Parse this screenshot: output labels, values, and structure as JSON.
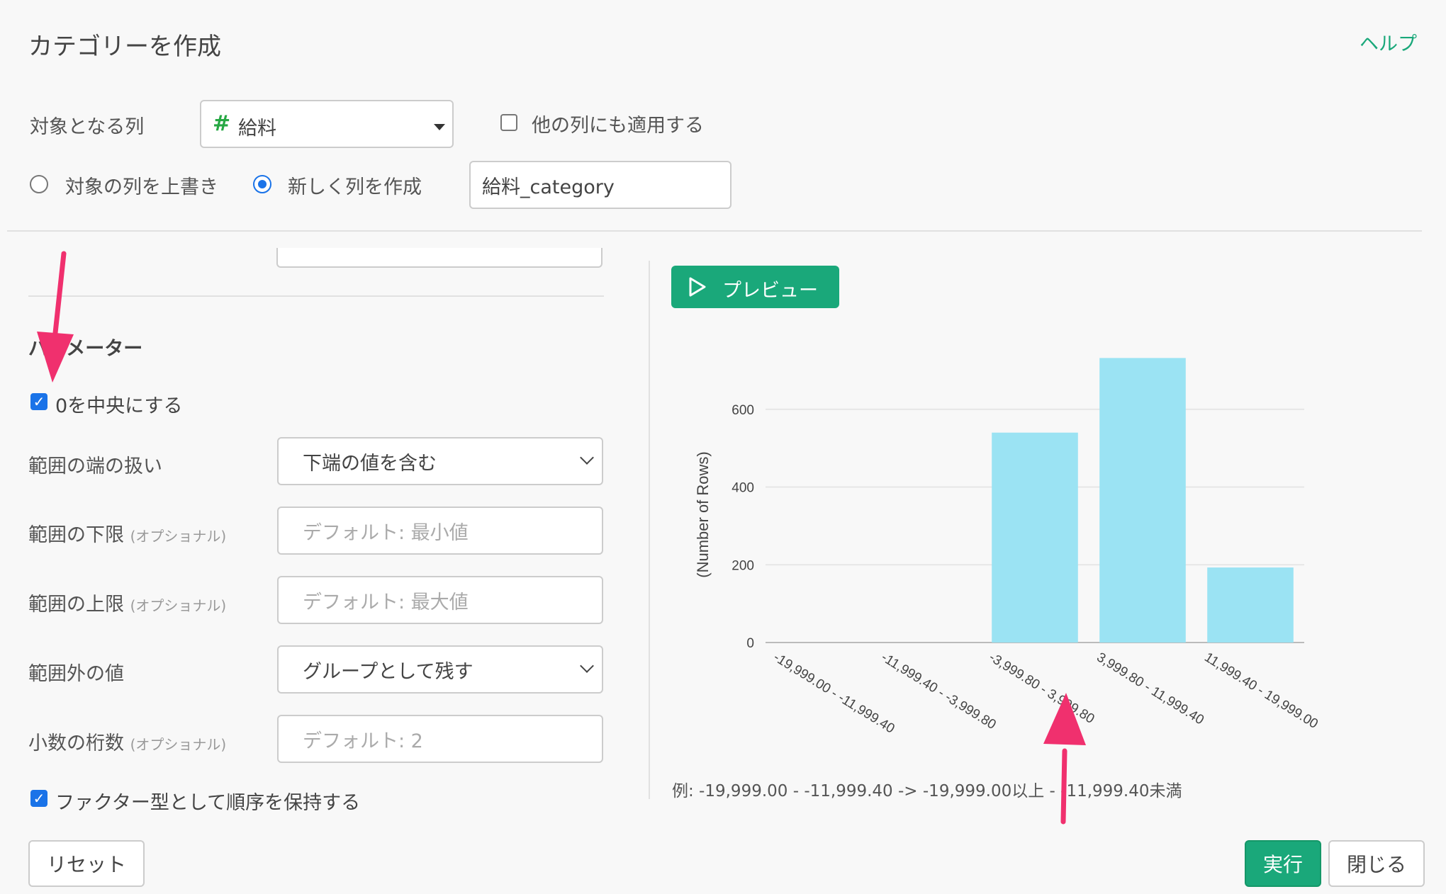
{
  "header": {
    "title": "カテゴリーを作成",
    "help": "ヘルプ"
  },
  "target": {
    "label": "対象となる列",
    "column_icon": "#",
    "column_value": "給料",
    "apply_other_label": "他の列にも適用する",
    "apply_other_checked": false
  },
  "output_mode": {
    "overwrite_label": "対象の列を上書き",
    "new_column_label": "新しく列を作成",
    "selected": "new_column",
    "new_column_name": "給料_category"
  },
  "parameters": {
    "section_title": "パラメーター",
    "center_zero_label": "0を中央にする",
    "center_zero_checked": true,
    "edge_handling": {
      "label": "範囲の端の扱い",
      "value": "下端の値を含む"
    },
    "lower": {
      "label": "範囲の下限",
      "optional": "(オプショナル)",
      "placeholder": "デフォルト: 最小値"
    },
    "upper": {
      "label": "範囲の上限",
      "optional": "(オプショナル)",
      "placeholder": "デフォルト: 最大値"
    },
    "out_of_range": {
      "label": "範囲外の値",
      "value": "グループとして残す"
    },
    "decimals": {
      "label": "小数の桁数",
      "optional": "(オプショナル)",
      "placeholder": "デフォルト: 2"
    },
    "keep_order_label": "ファクター型として順序を保持する",
    "keep_order_checked": true
  },
  "preview": {
    "button_label": "プレビュー",
    "example": "例: -19,999.00 - -11,999.40 -> -19,999.00以上 - -11,999.40未満"
  },
  "chart_data": {
    "type": "bar",
    "ylabel": "(Number of Rows)",
    "xlabel": "",
    "categories": [
      "-19,999.00 - -11,999.40",
      "-11,999.40 - -3,999.80",
      "-3,999.80 - 3,999.80",
      "3,999.80 - 11,999.40",
      "11,999.40 - 19,999.00"
    ],
    "values": [
      0,
      0,
      540,
      732,
      193
    ],
    "yticks": [
      0,
      200,
      400,
      600
    ],
    "ylim": [
      0,
      760
    ],
    "bar_color": "#9be3f3",
    "grid": true
  },
  "footer": {
    "reset": "リセット",
    "run": "実行",
    "close": "閉じる"
  },
  "colors": {
    "accent": "#1aa87a",
    "checkbox": "#1a73e8",
    "annotation_arrow": "#f0306e"
  }
}
